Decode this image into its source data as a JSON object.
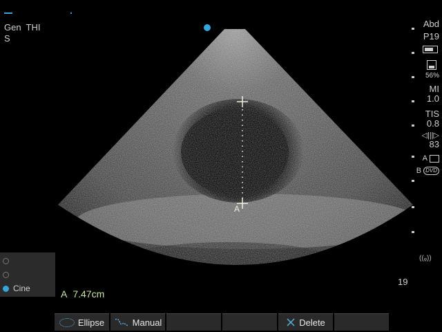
{
  "header": {
    "mode_line1": "Gen  THI",
    "mode_line2": "S"
  },
  "right_panel": {
    "preset": "Abd",
    "probe": "P19",
    "percent": "56%",
    "mi_label": "MI",
    "mi_value": "1.0",
    "tis_label": "TIS",
    "tis_value": "0.8",
    "gain": "83",
    "a_label": "A",
    "b_label": "B",
    "dvd_label": "DVD",
    "depth": "19"
  },
  "measurement": {
    "label": "A",
    "value": "7.47cm",
    "caliper_label": "A"
  },
  "left_panel": {
    "options": [
      "",
      "",
      "Cine"
    ],
    "selected": "Cine"
  },
  "bottom_bar": {
    "buttons": [
      {
        "label": "Ellipse",
        "icon": "ellipse-icon"
      },
      {
        "label": "Manual",
        "icon": "manual-trace-icon"
      },
      {
        "label": "",
        "icon": ""
      },
      {
        "label": "",
        "icon": ""
      },
      {
        "label": "Delete",
        "icon": "delete-x-icon"
      },
      {
        "label": "",
        "icon": ""
      }
    ]
  },
  "colors": {
    "accent": "#36a6d9",
    "measure_text": "#c8e6a0"
  }
}
